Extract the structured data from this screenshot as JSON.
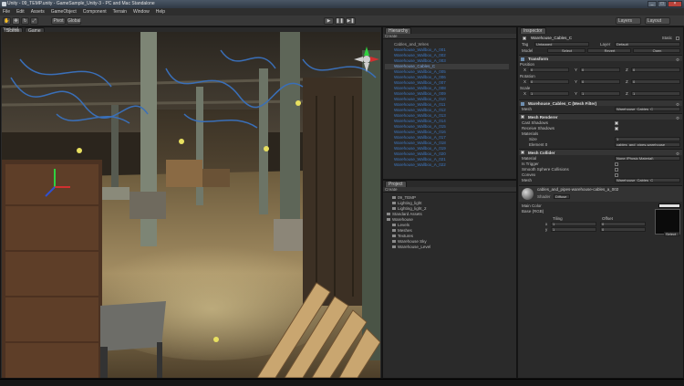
{
  "window": {
    "title": "Unity - 09_TEMP.unity - GameSample_Unity-3 - PC and Mac Standalone"
  },
  "menu": [
    "File",
    "Edit",
    "Assets",
    "GameObject",
    "Component",
    "Terrain",
    "Window",
    "Help"
  ],
  "toolbar": {
    "pivot_label": "Pivot",
    "global_label": "Global",
    "layers_label": "Layers",
    "layout_label": "Layout"
  },
  "scene": {
    "tab_scene": "Scene",
    "tab_game": "Game",
    "shading_mode": "Textured",
    "render_path": "RGB",
    "gizmos_label": "Gizmos",
    "search_placeholder": "All"
  },
  "hierarchy": {
    "tab": "Hierarchy",
    "create_label": "Create",
    "items": [
      "Cables_and_Wires",
      "Warehouse_Wallbox_A_001",
      "Warehouse_Wallbox_A_002",
      "Warehouse_Wallbox_A_003",
      "Warehouse_Cables_C",
      "Warehouse_Wallbox_A_005",
      "Warehouse_Wallbox_A_006",
      "Warehouse_Wallbox_A_007",
      "Warehouse_Wallbox_A_008",
      "Warehouse_Wallbox_A_009",
      "Warehouse_Wallbox_A_010",
      "Warehouse_Wallbox_A_011",
      "Warehouse_Wallbox_A_012",
      "Warehouse_Wallbox_A_013",
      "Warehouse_Wallbox_A_014",
      "Warehouse_Wallbox_A_015",
      "Warehouse_Wallbox_A_016",
      "Warehouse_Wallbox_A_017",
      "Warehouse_Wallbox_A_018",
      "Warehouse_Wallbox_A_019",
      "Warehouse_Wallbox_A_020",
      "Warehouse_Wallbox_A_021",
      "Warehouse_Wallbox_A_022"
    ],
    "selected_index": 4
  },
  "project": {
    "tab": "Project",
    "create_label": "Create",
    "items": [
      {
        "label": "09_TEMP",
        "indent": 1
      },
      {
        "label": "Lighting_light",
        "indent": 1
      },
      {
        "label": "Lighting_light_2",
        "indent": 1
      },
      {
        "label": "Standard Assets",
        "indent": 0
      },
      {
        "label": "Warehouse",
        "indent": 0
      },
      {
        "label": "Levels",
        "indent": 1
      },
      {
        "label": "Meshes",
        "indent": 1
      },
      {
        "label": "Textures",
        "indent": 1
      },
      {
        "label": "Warehouse Sky",
        "indent": 1
      },
      {
        "label": "Warehouse_Level",
        "indent": 1
      }
    ]
  },
  "inspector": {
    "tab": "Inspector",
    "object_name": "Warehouse_Cables_C",
    "static_label": "Static",
    "tag_label": "Tag",
    "tag_value": "Untagged",
    "layer_label": "Layer",
    "layer_value": "Default",
    "model_label": "Model",
    "model_buttons": [
      "Select",
      "Revert",
      "Open"
    ],
    "transform": {
      "title": "Transform",
      "position": {
        "label": "Position",
        "x": "0",
        "y": "0",
        "z": "0"
      },
      "rotation": {
        "label": "Rotation",
        "x": "0",
        "y": "0",
        "z": "0"
      },
      "scale": {
        "label": "Scale",
        "x": "1",
        "y": "1",
        "z": "1"
      }
    },
    "mesh_filter": {
      "title": "Warehouse_Cables_C (Mesh Filter)",
      "mesh_label": "Mesh",
      "mesh_value": "Warehouse_Cables_C"
    },
    "mesh_renderer": {
      "title": "Mesh Renderer",
      "cast_shadows": "Cast Shadows",
      "receive_shadows": "Receive Shadows",
      "materials": "Materials",
      "size_label": "Size",
      "size_value": "1",
      "element0_label": "Element 0",
      "element0_value": "cables_and_pipes-warehouse"
    },
    "mesh_collider": {
      "title": "Mesh Collider",
      "material_label": "Material",
      "material_value": "None (Physic Material)",
      "is_trigger": "Is Trigger",
      "smooth": "Smooth Sphere Collisions",
      "convex": "Convex",
      "mesh_label": "Mesh",
      "mesh_value": "Warehouse_Cables_C"
    },
    "material": {
      "name": "cables_and_pipes-warehouse-cables_a_002",
      "shader_label": "Shader",
      "shader_value": "Diffuse",
      "main_color": "Main Color",
      "base_rgb": "Base (RGB)",
      "tiling": "Tiling",
      "offset": "Offset",
      "x_label": "x",
      "y_label": "y",
      "tiling_x": "1",
      "tiling_y": "1",
      "offset_x": "0",
      "offset_y": "0",
      "select_label": "Select"
    }
  },
  "colors": {
    "accent": "#3d78c4",
    "background": "#202020"
  }
}
